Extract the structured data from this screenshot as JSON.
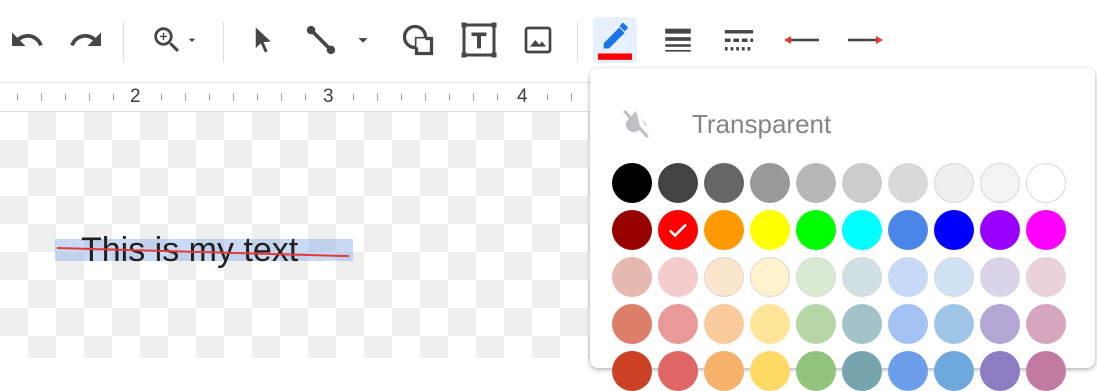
{
  "toolbar": {
    "items": [
      {
        "name": "undo-icon"
      },
      {
        "name": "redo-icon"
      },
      {
        "name": "zoom-icon"
      },
      {
        "name": "select-icon"
      },
      {
        "name": "line-icon"
      },
      {
        "name": "shape-icon"
      },
      {
        "name": "textbox-icon"
      },
      {
        "name": "image-icon"
      },
      {
        "name": "line-color-icon",
        "active": true,
        "indicator_color": "#ff0000"
      },
      {
        "name": "line-weight-icon"
      },
      {
        "name": "line-dash-icon"
      },
      {
        "name": "line-start-icon"
      },
      {
        "name": "line-end-icon"
      }
    ]
  },
  "ruler": {
    "numbers": [
      "2",
      "3",
      "4"
    ]
  },
  "canvas": {
    "text": "This is my text",
    "strike_color": "#e53935"
  },
  "color_panel": {
    "transparent_label": "Transparent",
    "selected_color": "#ff0000",
    "rows": [
      [
        "#000000",
        "#434343",
        "#666666",
        "#999999",
        "#b7b7b7",
        "#cccccc",
        "#d9d9d9",
        "#efefef",
        "#f3f3f3",
        "#ffffff"
      ],
      [
        "#980000",
        "#ff0000",
        "#ff9900",
        "#ffff00",
        "#00ff00",
        "#00ffff",
        "#4a86e8",
        "#0000ff",
        "#9900ff",
        "#ff00ff"
      ],
      [
        "#e6b8af",
        "#f4cccc",
        "#fce5cd",
        "#fff2cc",
        "#d9ead3",
        "#d0e0e3",
        "#c9daf8",
        "#cfe2f3",
        "#d9d2e9",
        "#ead1dc"
      ],
      [
        "#dd7e6b",
        "#ea9999",
        "#f9cb9c",
        "#ffe599",
        "#b6d7a8",
        "#a2c4c9",
        "#a4c2f4",
        "#9fc5e8",
        "#b4a7d6",
        "#d5a6bd"
      ],
      [
        "#cc4125",
        "#e06666",
        "#f6b26b",
        "#ffd966",
        "#93c47d",
        "#76a5af",
        "#6d9eeb",
        "#6fa8dc",
        "#8e7cc3",
        "#c27ba0"
      ]
    ]
  }
}
